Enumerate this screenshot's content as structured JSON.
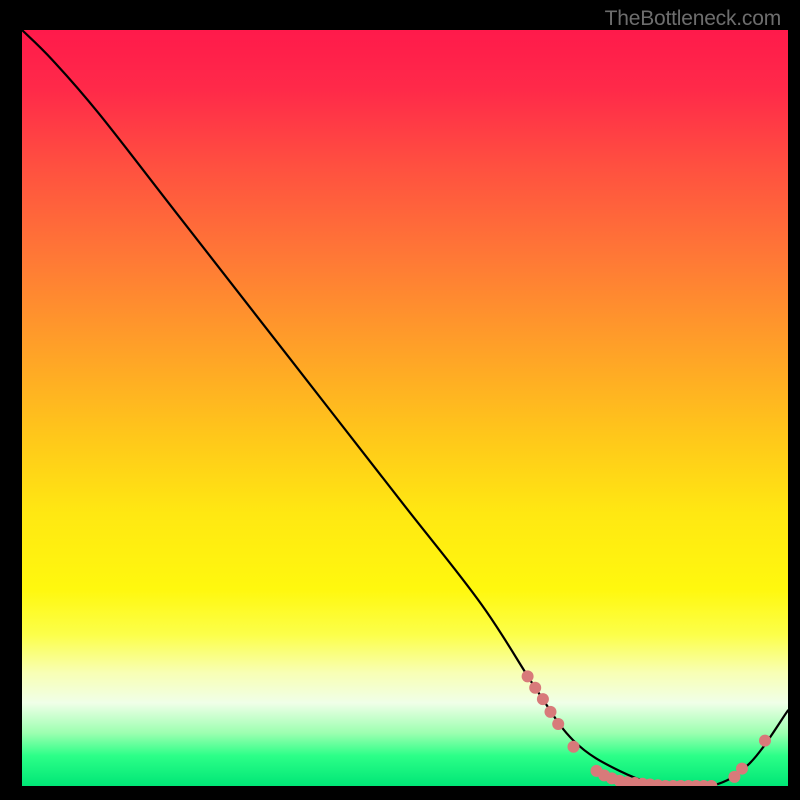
{
  "watermark": "TheBottleneck.com",
  "chart_data": {
    "type": "line",
    "title": "",
    "xlabel": "",
    "ylabel": "",
    "xlim": [
      0,
      100
    ],
    "ylim": [
      0,
      100
    ],
    "grid": false,
    "legend": false,
    "background_gradient": {
      "orientation": "vertical",
      "stops": [
        {
          "pos": 0.0,
          "color": "#ff1a4b"
        },
        {
          "pos": 0.5,
          "color": "#ffd015"
        },
        {
          "pos": 0.85,
          "color": "#f5ffd8"
        },
        {
          "pos": 1.0,
          "color": "#00e676"
        }
      ]
    },
    "series": [
      {
        "name": "bottleneck-curve",
        "color": "#000000",
        "x": [
          0,
          4,
          10,
          20,
          30,
          40,
          50,
          60,
          67,
          72,
          78,
          84,
          90,
          95,
          100
        ],
        "y": [
          100,
          96,
          89,
          76,
          63,
          50,
          37,
          24,
          13,
          6,
          2,
          0,
          0,
          3,
          10
        ]
      }
    ],
    "markers": {
      "name": "highlight-points",
      "color": "#d87a7a",
      "radius": 6,
      "points": [
        {
          "x": 66,
          "y": 14.5
        },
        {
          "x": 67,
          "y": 13.0
        },
        {
          "x": 68,
          "y": 11.5
        },
        {
          "x": 69,
          "y": 9.8
        },
        {
          "x": 70,
          "y": 8.2
        },
        {
          "x": 72,
          "y": 5.2
        },
        {
          "x": 75,
          "y": 2.0
        },
        {
          "x": 76,
          "y": 1.4
        },
        {
          "x": 77,
          "y": 1.0
        },
        {
          "x": 78,
          "y": 0.7
        },
        {
          "x": 79,
          "y": 0.5
        },
        {
          "x": 80,
          "y": 0.4
        },
        {
          "x": 81,
          "y": 0.3
        },
        {
          "x": 82,
          "y": 0.2
        },
        {
          "x": 83,
          "y": 0.1
        },
        {
          "x": 84,
          "y": 0.0
        },
        {
          "x": 85,
          "y": 0.0
        },
        {
          "x": 86,
          "y": 0.0
        },
        {
          "x": 87,
          "y": 0.0
        },
        {
          "x": 88,
          "y": 0.0
        },
        {
          "x": 89,
          "y": 0.0
        },
        {
          "x": 90,
          "y": 0.0
        },
        {
          "x": 93,
          "y": 1.2
        },
        {
          "x": 94,
          "y": 2.3
        },
        {
          "x": 97,
          "y": 6.0
        }
      ]
    }
  }
}
